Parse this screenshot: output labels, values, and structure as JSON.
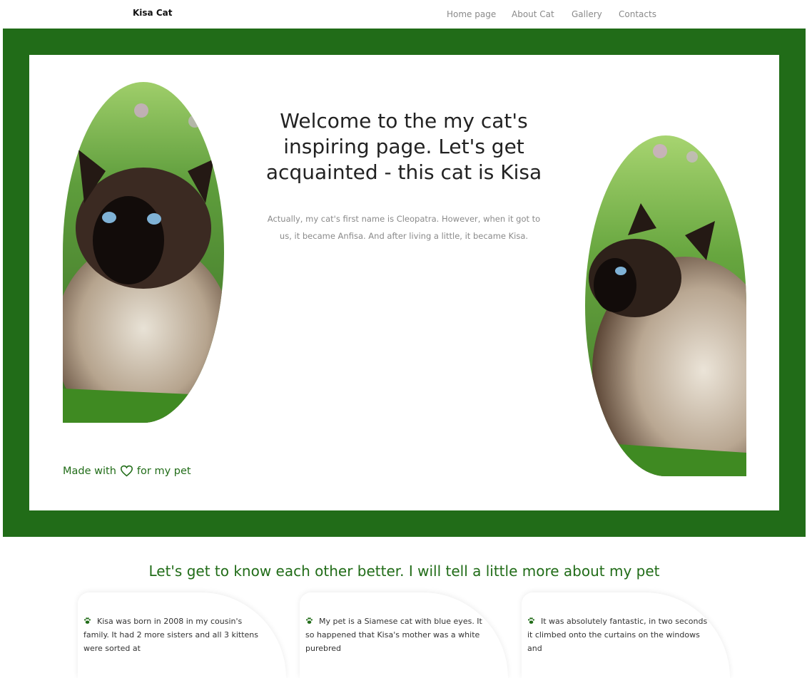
{
  "nav": {
    "brand": "Kisa Cat",
    "links": [
      {
        "label": "Home page"
      },
      {
        "label": "About Cat"
      },
      {
        "label": "Gallery"
      },
      {
        "label": "Contacts"
      }
    ]
  },
  "hero": {
    "title": "Welcome to the my cat's inspiring page. Let's get acquainted - this cat is Kisa",
    "description": "Actually, my cat's first name is Cleopatra. However, when it got to us, it became Anfisa. And after living a little, it became Kisa.",
    "made_with_prefix": "Made with",
    "made_with_suffix": "for my pet",
    "heart_icon": "heart-icon",
    "colors": {
      "accent": "#216c18",
      "text": "#222222",
      "muted": "#8a8a8a"
    }
  },
  "about": {
    "title": "Let's get to know each other better. I will tell a little more about my pet",
    "cards": [
      {
        "icon": "paw-icon",
        "text": "Kisa was born in 2008 in my cousin's family. It had 2 more sisters and all 3 kittens were sorted at"
      },
      {
        "icon": "paw-icon",
        "text": "My pet is a Siamese cat with blue eyes. It so happened that Kisa's mother was a white purebred"
      },
      {
        "icon": "paw-icon",
        "text": "It was absolutely fantastic, in two seconds it climbed onto the curtains on the windows and"
      }
    ]
  }
}
